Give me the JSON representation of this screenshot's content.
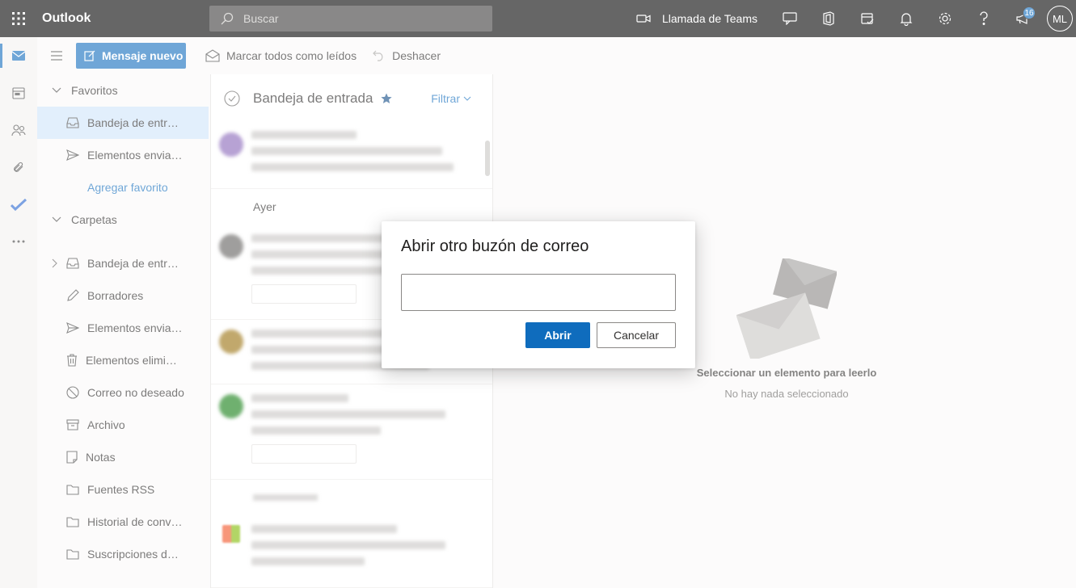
{
  "app": {
    "name": "Outlook"
  },
  "search": {
    "placeholder": "Buscar"
  },
  "topbar": {
    "teams_call_label": "Llamada de Teams",
    "notifications_badge": "16",
    "avatar_initials": "ML"
  },
  "commandbar": {
    "new_mail_label": "Mensaje nuevo",
    "mark_all_read_label": "Marcar todos como leídos",
    "undo_label": "Deshacer"
  },
  "folders": {
    "favorites_header": "Favoritos",
    "favorites": [
      {
        "label": "Bandeja de entrada",
        "icon": "inbox-icon"
      },
      {
        "label": "Elementos enviados",
        "icon": "send-icon"
      }
    ],
    "add_favorite_label": "Agregar favorito",
    "folders_header": "Carpetas",
    "items": [
      {
        "label": "Bandeja de entrada",
        "icon": "inbox-icon"
      },
      {
        "label": "Borradores",
        "icon": "pencil-icon"
      },
      {
        "label": "Elementos enviados",
        "icon": "send-icon"
      },
      {
        "label": "Elementos eliminados",
        "icon": "trash-icon"
      },
      {
        "label": "Correo no deseado",
        "icon": "block-icon"
      },
      {
        "label": "Archivo",
        "icon": "archive-icon"
      },
      {
        "label": "Notas",
        "icon": "note-icon"
      },
      {
        "label": "Fuentes RSS",
        "icon": "folder-icon"
      },
      {
        "label": "Historial de conversaciones",
        "icon": "folder-icon"
      },
      {
        "label": "Suscripciones de RSS",
        "icon": "folder-icon"
      }
    ]
  },
  "message_list": {
    "title": "Bandeja de entrada",
    "filter_label": "Filtrar",
    "day_yesterday": "Ayer"
  },
  "reading_pane": {
    "empty_title": "Seleccionar un elemento para leerlo",
    "empty_subtitle": "No hay nada seleccionado"
  },
  "dialog": {
    "title": "Abrir otro buzón de correo",
    "input_value": "",
    "open_label": "Abrir",
    "cancel_label": "Cancelar"
  },
  "colors": {
    "accent": "#0f6cbd",
    "topbar": "#000000",
    "selected_folder": "#cfe4fa"
  }
}
